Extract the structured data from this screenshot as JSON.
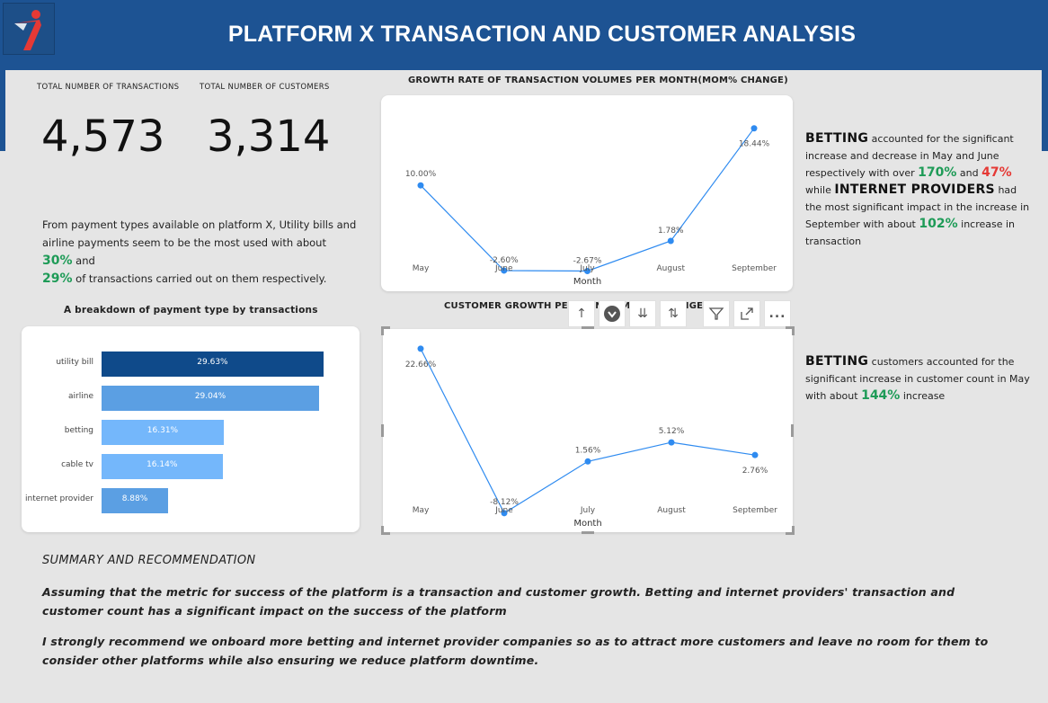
{
  "header": {
    "title": "PLATFORM X TRANSACTION AND CUSTOMER ANALYSIS",
    "brand_color": "#1d5393",
    "logo_icon": "running-figure-logo"
  },
  "kpis": {
    "transactions": {
      "label": "TOTAL NUMBER OF TRANSACTIONS",
      "value": "4,573"
    },
    "customers": {
      "label": "TOTAL NUMBER OF CUSTOMERS",
      "value": "3,314"
    }
  },
  "payment_insight": {
    "text_1": "From payment types available on platform X, Utility bills and airline payments seem to be the most used with about ",
    "pct_1": "30%",
    "text_2": " and ",
    "pct_2": "29%",
    "text_3": " of transactions carried out on them respectively."
  },
  "betting_insight": {
    "word_betting": "BETTING",
    "text_1": " accounted for the significant increase and decrease in May and June respectively with over ",
    "pct_up": "170%",
    "text_2": " and ",
    "pct_down": "47%",
    "text_3": " while ",
    "word_internet": "INTERNET PROVIDERS",
    "text_4": " had the most significant impact in the increase in September with about ",
    "pct_internet": "102%",
    "text_5": " increase in transaction"
  },
  "customer_insight": {
    "word_betting": "BETTING",
    "text_1": " customers accounted for the significant increase in customer count in May with about ",
    "pct": "144%",
    "text_2": " increase"
  },
  "charts": {
    "transaction_growth_title": "GROWTH RATE OF TRANSACTION VOLUMES PER MONTH(MOM% CHANGE)",
    "customer_growth_title": "CUSTOMER GROWTH PER MONTH(MOM% CHANGE)",
    "payment_breakdown_title": "A breakdown of payment type by transactions"
  },
  "toolbar": {
    "icons": [
      "drill-up-icon",
      "drill-down-icon",
      "expand-next-level-icon",
      "expand-all-icon",
      "filter-icon",
      "focus-mode-icon",
      "more-options-icon"
    ],
    "more_label": "..."
  },
  "summary": {
    "heading": "SUMMARY AND RECOMMENDATION",
    "paragraph_1": "Assuming that the metric for success of the platform is a transaction and customer growth. Betting and internet providers' transaction and customer count has a significant impact on the success of the platform",
    "paragraph_2": "I strongly recommend we onboard more betting and internet provider companies so as to attract more customers and leave no room for them to consider other platforms while also ensuring we reduce platform downtime."
  },
  "colors": {
    "line": "#2f8bf0",
    "bar_dark": "#0f4a8a",
    "bar_mid": "#5b9fe3",
    "bar_light": "#74b7fb",
    "positive": "#1e9b57",
    "negative": "#e53935"
  },
  "chart_data": [
    {
      "type": "line",
      "title": "GROWTH RATE OF TRANSACTION VOLUMES PER MONTH(MOM% CHANGE)",
      "xlabel": "Month",
      "ylabel": "",
      "x": [
        "May",
        "June",
        "July",
        "August",
        "September"
      ],
      "values": [
        10.0,
        -2.6,
        -2.67,
        1.78,
        18.44
      ],
      "labels": [
        "10.00%",
        "-2.60%",
        "-2.67%",
        "1.78%",
        "18.44%"
      ],
      "ylim": [
        -5,
        20
      ],
      "grid": false
    },
    {
      "type": "line",
      "title": "CUSTOMER GROWTH PER MONTH(MOM% CHANGE)",
      "xlabel": "Month",
      "ylabel": "",
      "x": [
        "May",
        "June",
        "July",
        "August",
        "September"
      ],
      "values": [
        22.66,
        -8.12,
        1.56,
        5.12,
        2.76
      ],
      "labels": [
        "22.66%",
        "-8.12%",
        "1.56%",
        "5.12%",
        "2.76%"
      ],
      "ylim": [
        -10,
        25
      ],
      "grid": false
    },
    {
      "type": "bar",
      "orientation": "horizontal",
      "title": "A breakdown of payment type by transactions",
      "categories": [
        "utility bill",
        "airline",
        "betting",
        "cable tv",
        "internet provider"
      ],
      "values": [
        29.63,
        29.04,
        16.31,
        16.14,
        8.88
      ],
      "labels": [
        "29.63%",
        "29.04%",
        "16.31%",
        "16.14%",
        "8.88%"
      ],
      "xlim": [
        0,
        30
      ],
      "grid": false
    }
  ]
}
